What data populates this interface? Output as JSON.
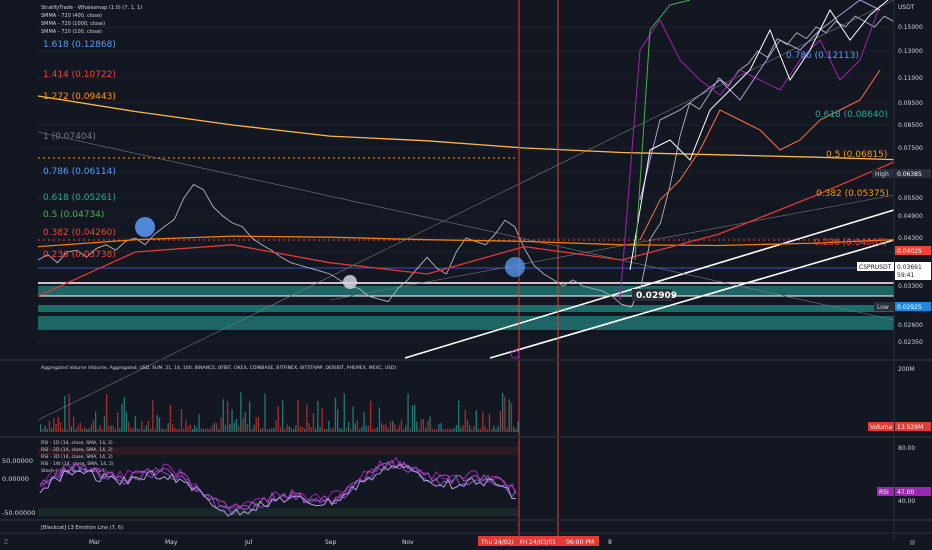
{
  "colors": {
    "background": "#131722",
    "grid": "#1e222d",
    "fib_blue": "#5b9cf6",
    "fib_red": "#f44336",
    "fib_orange": "#ff9800",
    "fib_gray": "#787b86",
    "fib_teal": "#26a69a",
    "fib_green": "#4caf50",
    "teal_zone": "#26a69a",
    "price_line": "#b2b5be",
    "smma_orange": "#f57c00",
    "smma_red": "#e53935",
    "smma_peach": "#ffb74d",
    "rsi_purple": "#9c27b0",
    "rsi_lavender": "#b39ddb",
    "white": "#ffffff",
    "vertical_marker": "#e53935"
  },
  "header": {
    "line1": "StratifyTrade - Whalesmap (1.0) (7, 1, 1)",
    "line2": "SMMA - 720 (400, close)",
    "line3": "SMMA - 720 (1000, close)",
    "line4": "SMMA - 720 (100, close)"
  },
  "currency": "USDT",
  "fib_left": [
    {
      "label": "1.618 (0.12868)",
      "color": "#5b9cf6"
    },
    {
      "label": "1.414 (0.10722)",
      "color": "#f44336"
    },
    {
      "label": "1.272 (0.09443)",
      "color": "#ff9800"
    },
    {
      "label": "1 (0.07404)",
      "color": "#787b86"
    },
    {
      "label": "0.786 (0.06114)",
      "color": "#5b9cf6"
    },
    {
      "label": "0.618 (0.05261)",
      "color": "#26a69a"
    },
    {
      "label": "0.5 (0.04734)",
      "color": "#4caf50"
    },
    {
      "label": "0.382 (0.04260)",
      "color": "#f44336"
    },
    {
      "label": "0.236 (0.03738)",
      "color": "#f44336"
    }
  ],
  "fib_right": [
    {
      "label": "0.786 (0.12113)",
      "color": "#5b9cf6"
    },
    {
      "label": "0.618 (0.08640)",
      "color": "#26a69a"
    },
    {
      "label": "0.5 (0.06815)",
      "color": "#ff9800"
    },
    {
      "label": "0.382 (0.05375)",
      "color": "#ff9800"
    },
    {
      "label": "0.236 (0.04007)",
      "color": "#f44336"
    }
  ],
  "price_axis": [
    "0.15000",
    "0.13000",
    "0.11000",
    "0.09500",
    "0.08500",
    "0.07500",
    "0.06500",
    "0.05500",
    "0.04900",
    "0.04300",
    "0.03900",
    "0.03300",
    "0.02600",
    "0.02350"
  ],
  "price_tags": {
    "high_label": "High",
    "high_value": "0.06385",
    "level_value": "0.04025",
    "symbol": "CSPRUSDT",
    "symbol_price": "0.03691",
    "countdown": "59:41",
    "low_label": "Low",
    "low_value": "0.02925",
    "callout": "0.02909"
  },
  "volume": {
    "title": "Aggregated Volume (Volume, Aggregated, USD, SUM, 21, 14, 100, BINANCE, BYBIT, OKEX, COINBASE, BITFINEX, BITSTAMP, DERIBIT, PHEMEX, MEXC, USD)",
    "axis_top": "200M",
    "volume_label": "Volume",
    "volume_value": "13.929M"
  },
  "rsi": {
    "legend": [
      "RSI - 1D (14, close, SMA, 14, 2)",
      "RSI - 2D (14, close, SMA, 14, 2)",
      "RSI - 3D (14, close, SMA, 14, 2)",
      "RSI - 1W (14, close, SMA, 14, 2)",
      "Stoch (close, 8, 3, 3, 14, 14)"
    ],
    "left_axis": [
      "50.00000",
      "0.00000",
      "-50.00000"
    ],
    "right_axis": [
      "80.00",
      "40.00"
    ],
    "rsi_label": "RSI",
    "rsi_value": "47.00"
  },
  "bottom_legend": "[Blackcat] L3 Emotion Line (7, 6)",
  "time_axis": [
    "Mar",
    "May",
    "Jul",
    "Sep",
    "Nov",
    "8"
  ],
  "date_tags": {
    "tag1": "Thu 24/02/",
    "tag2": "Fri 24/03/01",
    "tag3": "06:00 PM"
  },
  "corner_left": "Z",
  "corner_right": "⊗",
  "chart_data": {
    "type": "line",
    "title": "CSPRUSDT",
    "x_ticks": [
      "Mar",
      "May",
      "Jul",
      "Sep",
      "Nov",
      "8"
    ],
    "y_ticks": [
      0.15,
      0.13,
      0.11,
      0.095,
      0.085,
      0.075,
      0.065,
      0.055,
      0.049,
      0.043,
      0.039,
      0.033,
      0.026,
      0.0235
    ],
    "series": [
      {
        "name": "CSPRUSDT",
        "color": "#b2b5be",
        "x": [
          0,
          10,
          20,
          30,
          40,
          50,
          60,
          70,
          80,
          90,
          100,
          110,
          120,
          130,
          140,
          150,
          160,
          170,
          180,
          190,
          200,
          210,
          220,
          230,
          240,
          250,
          260,
          270,
          280,
          290,
          300,
          310,
          320,
          330,
          340,
          350,
          360,
          370,
          380,
          390,
          400,
          410,
          420,
          430,
          440,
          450,
          460,
          470,
          480,
          490,
          500,
          510,
          520,
          530,
          540,
          550,
          560,
          570,
          580,
          590,
          600,
          610,
          620,
          630,
          640,
          650,
          660,
          670,
          680,
          690,
          700,
          710,
          720,
          730,
          740,
          750,
          760,
          770,
          780,
          790,
          800,
          810,
          820,
          830,
          840,
          850,
          860,
          870,
          880
        ],
        "y": [
          0.0375,
          0.0385,
          0.037,
          0.039,
          0.0395,
          0.038,
          0.04,
          0.041,
          0.0395,
          0.042,
          0.043,
          0.041,
          0.044,
          0.046,
          0.048,
          0.055,
          0.06,
          0.058,
          0.052,
          0.049,
          0.047,
          0.046,
          0.043,
          0.041,
          0.0395,
          0.038,
          0.037,
          0.0365,
          0.036,
          0.0355,
          0.035,
          0.034,
          0.033,
          0.0325,
          0.031,
          0.0305,
          0.03,
          0.0325,
          0.034,
          0.036,
          0.038,
          0.036,
          0.035,
          0.039,
          0.043,
          0.042,
          0.041,
          0.044,
          0.0478,
          0.046,
          0.04,
          0.0365,
          0.035,
          0.034,
          0.033,
          0.034,
          0.033,
          0.0325,
          0.032,
          0.031,
          0.0295,
          0.029,
          0.033,
          0.043,
          0.047,
          0.06,
          0.08,
          0.095,
          0.092,
          0.1,
          0.11,
          0.105,
          0.115,
          0.12,
          0.13,
          0.125,
          0.14,
          0.135,
          0.145,
          0.14,
          0.15,
          0.145,
          0.155,
          0.15,
          0.16,
          0.155,
          0.15,
          0.16,
          0.155
        ]
      },
      {
        "name": "",
        "color": "#f57c00",
        "x": [
          0,
          100,
          200,
          300,
          400,
          500,
          600,
          700,
          800,
          880
        ],
        "y": [
          0.0405,
          0.0425,
          0.0435,
          0.0432,
          0.0425,
          0.042,
          0.041,
          0.0408,
          0.0415,
          0.0425
        ]
      },
      {
        "name": "",
        "color": "#e53935",
        "x": [
          0,
          100,
          200,
          300,
          400,
          500,
          600,
          700,
          800,
          880
        ],
        "y": [
          0.031,
          0.039,
          0.041,
          0.037,
          0.035,
          0.0405,
          0.0375,
          0.044,
          0.056,
          0.069
        ]
      },
      {
        "name": "",
        "color": "#ffb74d",
        "x": [
          0,
          100,
          200,
          300,
          400,
          500,
          600,
          700,
          800,
          880
        ],
        "y": [
          0.099,
          0.091,
          0.085,
          0.08,
          0.078,
          0.075,
          0.073,
          0.072,
          0.071,
          0.07
        ]
      }
    ]
  }
}
